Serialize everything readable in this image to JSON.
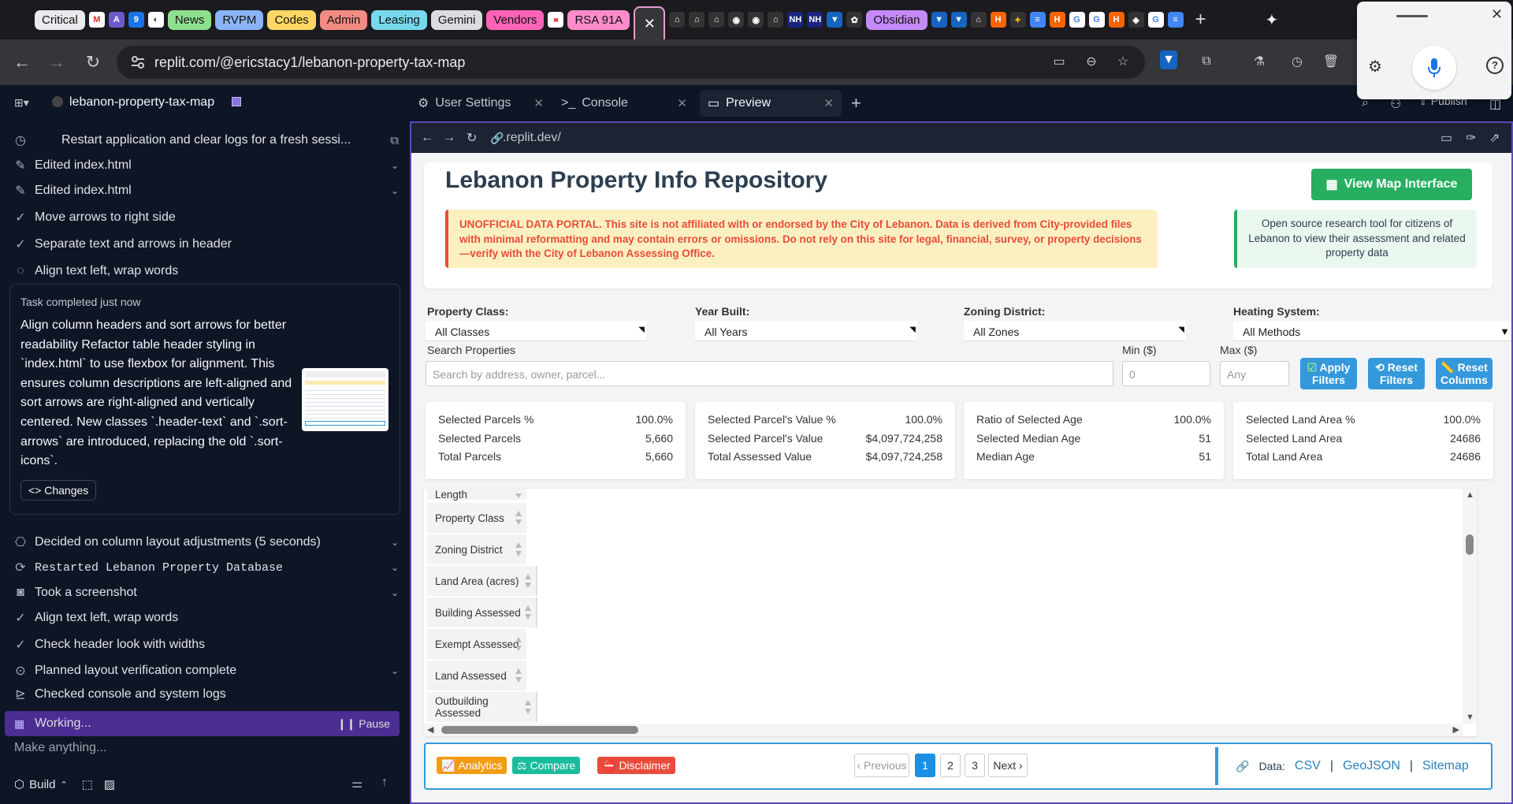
{
  "browser": {
    "bookmarks": [
      {
        "label": "Critical",
        "bg": "#e8eaed"
      },
      {
        "label": "News",
        "bg": "#8ee08e"
      },
      {
        "label": "RVPM",
        "bg": "#8ab4f8"
      },
      {
        "label": "Codes",
        "bg": "#fdd663"
      },
      {
        "label": "Admin",
        "bg": "#f28b82"
      },
      {
        "label": "Leasing",
        "bg": "#78d9ec"
      },
      {
        "label": "Gemini",
        "bg": "#dadce0"
      },
      {
        "label": "Vendors",
        "bg": "#ff63b8"
      },
      {
        "label": "RSA 91A",
        "bg": "#ff8bcb"
      },
      {
        "label": "Obsidian",
        "bg": "#c58af9"
      }
    ],
    "url": "replit.com/@ericstacy1/lebanon-property-tax-map"
  },
  "replit": {
    "project_name": "lebanon-property-tax-map",
    "tabs": [
      "User Settings",
      "Console",
      "Preview"
    ],
    "publish_label": "Publish",
    "preview_url": ".replit.dev/"
  },
  "agent": {
    "checkpoint": "Restart application and clear logs for a fresh sessi...",
    "edited1": "Edited index.html",
    "edited2": "Edited index.html",
    "steps_top": [
      "Move arrows to right side",
      "Separate text and arrows in header",
      "Align text left, wrap words"
    ],
    "task_status": "Task completed just now",
    "task_body": "Align column headers and sort arrows for better readability Refactor table header styling in `index.html` to use flexbox for alignment. This ensures column descriptions are left-aligned and sort arrows are right-aligned and vertically centered. New classes `.header-text` and `.sort-arrows` are introduced, replacing the old `.sort-icons`.",
    "changes_label": "Changes",
    "steps_bottom": [
      "Decided on column layout adjustments (5 seconds)",
      "Restarted Lebanon Property Database",
      "Took a screenshot",
      "Align text left, wrap words",
      "Check header look with widths",
      "Planned layout verification complete",
      "Checked console and system logs"
    ],
    "working_label": "Working...",
    "pause_label": "Pause",
    "input_placeholder": "Make anything...",
    "build_label": "Build"
  },
  "app": {
    "title": "Lebanon Property Info Repository",
    "map_button": "View Map Interface",
    "warning_strong": "UNOFFICIAL DATA PORTAL.",
    "warning_text": " This site is not affiliated with or endorsed by the City of Lebanon. Data is derived from City-provided files with minimal reformatting and may contain errors or omissions. Do not rely on this site for legal, financial, survey, or property decisions—verify with the City of Lebanon Assessing Office.",
    "info_text": "Open source research tool for citizens of Lebanon to view their assessment and related property data",
    "filters": [
      {
        "label": "Property Class:",
        "value": "All Classes"
      },
      {
        "label": "Year Built:",
        "value": "All Years"
      },
      {
        "label": "Zoning District:",
        "value": "All Zones"
      },
      {
        "label": "Heating System:",
        "value": "All Methods"
      }
    ],
    "search_label": "Search Properties",
    "search_placeholder": "Search by address, owner, parcel...",
    "min_label": "Min ($)",
    "min_placeholder": "0",
    "max_label": "Max ($)",
    "max_placeholder": "Any",
    "apply_label": "Apply Filters",
    "reset_filters_label": "Reset Filters",
    "reset_columns_label": "Reset Columns",
    "stats": [
      [
        [
          "Selected Parcels %",
          "100.0%"
        ],
        [
          "Selected Parcels",
          "5,660"
        ],
        [
          "Total Parcels",
          "5,660"
        ]
      ],
      [
        [
          "Selected Parcel's Value %",
          "100.0%"
        ],
        [
          "Selected Parcel's Value",
          "$4,097,724,258"
        ],
        [
          "Total Assessed Value",
          "$4,097,724,258"
        ]
      ],
      [
        [
          "Ratio of Selected Age",
          "100.0%"
        ],
        [
          "Selected Median Age",
          "51"
        ],
        [
          "Median Age",
          "51"
        ]
      ],
      [
        [
          "Selected Land Area %",
          "100.0%"
        ],
        [
          "Selected Land Area",
          "24686"
        ],
        [
          "Total Land Area",
          "24686"
        ]
      ]
    ],
    "columns": [
      "Length",
      "Property Class",
      "Zoning District",
      "Land Area (acres)",
      "Building Assessed",
      "Exempt Assessed",
      "Land Assessed",
      "Outbuilding Assessed"
    ],
    "footer_buttons": [
      "Analytics",
      "Compare",
      "Disclaimer"
    ],
    "pagination": {
      "prev": "‹ Previous",
      "pages": [
        "1",
        "2",
        "3"
      ],
      "next": "Next ›"
    },
    "data_label": "Data:",
    "data_links": [
      "CSV",
      "GeoJSON",
      "Sitemap"
    ]
  }
}
